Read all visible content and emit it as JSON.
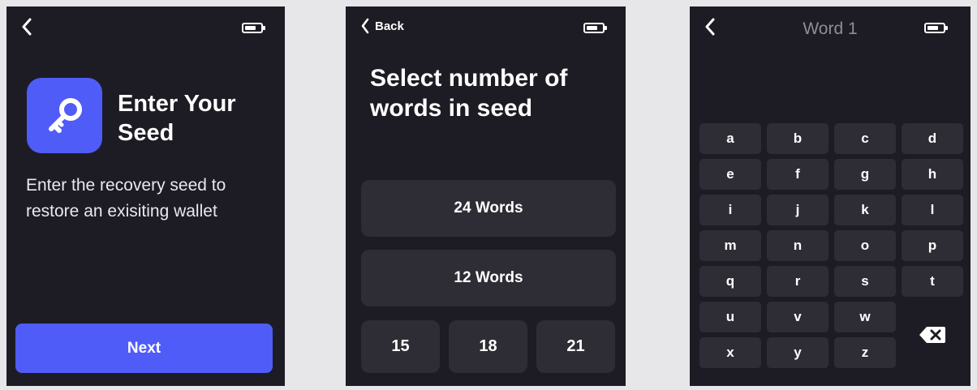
{
  "screen1": {
    "title": "Enter Your Seed",
    "description": "Enter the recovery seed to restore an exisiting wallet",
    "next_label": "Next",
    "key_icon": "key-icon",
    "accent_color": "#4f5cf7"
  },
  "screen2": {
    "back_label": "Back",
    "title": "Select number of words in seed",
    "options": [
      "24 Words",
      "12 Words"
    ],
    "small_options": [
      "15",
      "18",
      "21"
    ]
  },
  "screen3": {
    "title": "Word 1",
    "keys": [
      "a",
      "b",
      "c",
      "d",
      "e",
      "f",
      "g",
      "h",
      "i",
      "j",
      "k",
      "l",
      "m",
      "n",
      "o",
      "p",
      "q",
      "r",
      "s",
      "t",
      "u",
      "v",
      "w",
      "x",
      "y",
      "z"
    ],
    "backspace_icon": "backspace-icon"
  },
  "colors": {
    "screen_bg": "#1d1c24",
    "button_bg": "#2e2d35",
    "muted_text": "#8e8d97"
  }
}
